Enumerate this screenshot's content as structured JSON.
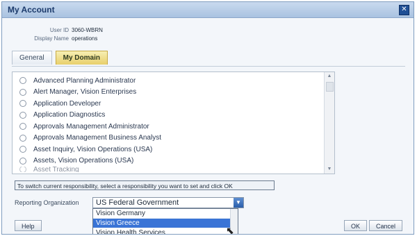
{
  "window": {
    "title": "My Account"
  },
  "account": {
    "user_id_label": "User ID",
    "user_id_value": "3060-WBRN",
    "display_name_label": "Display Name",
    "display_name_value": "operations"
  },
  "tabs": [
    {
      "label": "General",
      "active": false
    },
    {
      "label": "My Domain",
      "active": true
    }
  ],
  "responsibilities": [
    "Advanced Planning Administrator",
    "Alert Manager, Vision Enterprises",
    "Application Developer",
    "Application Diagnostics",
    "Approvals Management Administrator",
    "Approvals Management Business Analyst",
    "Asset Inquiry, Vision Operations (USA)",
    "Assets, Vision Operations (USA)",
    "Asset Tracking"
  ],
  "hint_text": "To switch current responsibility, select a responsibility you want to set and click OK",
  "organization": {
    "label": "Reporting Organization",
    "selected": "US Federal Government",
    "options": [
      {
        "label": "Vision Germany",
        "selected": false
      },
      {
        "label": "Vision Greece",
        "selected": true
      },
      {
        "label": "Vision Health Services",
        "selected": false
      }
    ]
  },
  "buttons": {
    "help": "Help",
    "ok": "OK",
    "cancel": "Cancel"
  },
  "icons": {
    "close": "close-icon",
    "dropdown": "chevron-down-icon",
    "cursor": "mouse-cursor-icon"
  },
  "colors": {
    "titlebar": "#b5cbe6",
    "active_tab": "#e8cf6a",
    "selection": "#3a74d6"
  }
}
